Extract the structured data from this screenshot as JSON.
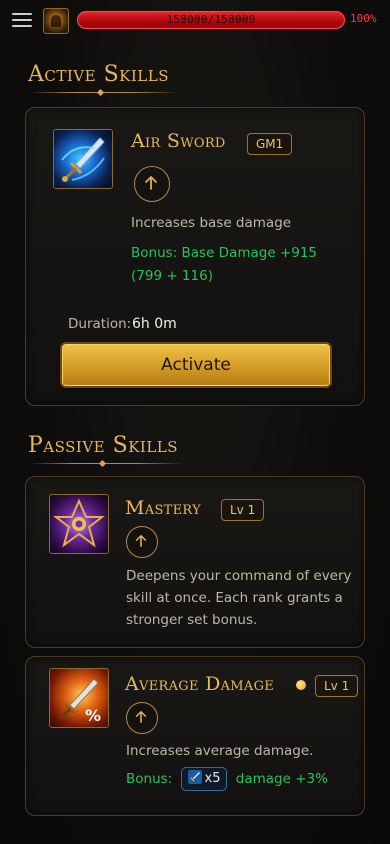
{
  "topbar": {
    "hp_text": "158000/158000",
    "hp_percent": "100%",
    "hp_fill_fraction": 1.0,
    "menu_icon": "hamburger-menu-icon",
    "avatar_icon": "character-avatar-icon"
  },
  "active_section": {
    "title": "Active Skills",
    "skill": {
      "name": "Air Sword",
      "tag": "GM1",
      "icon": "air-sword-icon",
      "description": "Increases base damage",
      "bonus_line1": "Bonus: Base Damage +915",
      "bonus_line2": "(799 + 116)",
      "duration_label": "Duration:",
      "duration_value": "6h 0m",
      "activate_label": "Activate"
    }
  },
  "passive_section": {
    "title": "Passive Skills",
    "skills": [
      {
        "name": "Mastery",
        "tag": "Lv 1",
        "icon": "mastery-crest-icon",
        "description_lines": [
          "Deepens your command of every",
          "skill at once. Each rank grants a",
          "stronger set bonus."
        ]
      },
      {
        "name": "Average Damage",
        "tag": "Lv 1",
        "icon": "sword-damage-percent-icon",
        "description": "Increases average damage.",
        "bonus_prefix": "Bonus:",
        "bonus_chip": "x5",
        "bonus_suffix": "damage +3%"
      }
    ]
  },
  "colors": {
    "accent_gold": "#e6b85a",
    "bonus_green": "#29c15a",
    "hp_red": "#d81a1f"
  }
}
